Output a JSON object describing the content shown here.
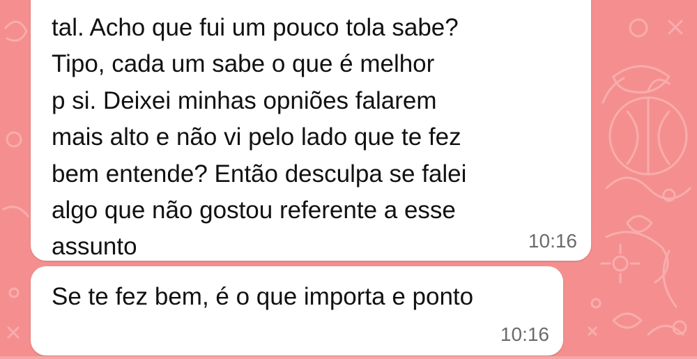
{
  "chat": {
    "theme_colors": {
      "wallpaper": "#f58f8f",
      "bubble": "#ffffff",
      "text": "#111111",
      "timestamp": "#6b6b6b"
    },
    "messages": [
      {
        "text": "tal. Acho que fui um pouco tola sabe?\nTipo, cada um sabe o que é melhor\np si. Deixei minhas opniões falarem\nmais alto e não vi pelo lado que te fez\nbem entende? Então desculpa se falei\nalgo que não gostou referente a esse\nassunto",
        "time": "10:16"
      },
      {
        "text": "Se te fez bem, é o que importa e ponto",
        "time": "10:16"
      }
    ]
  }
}
